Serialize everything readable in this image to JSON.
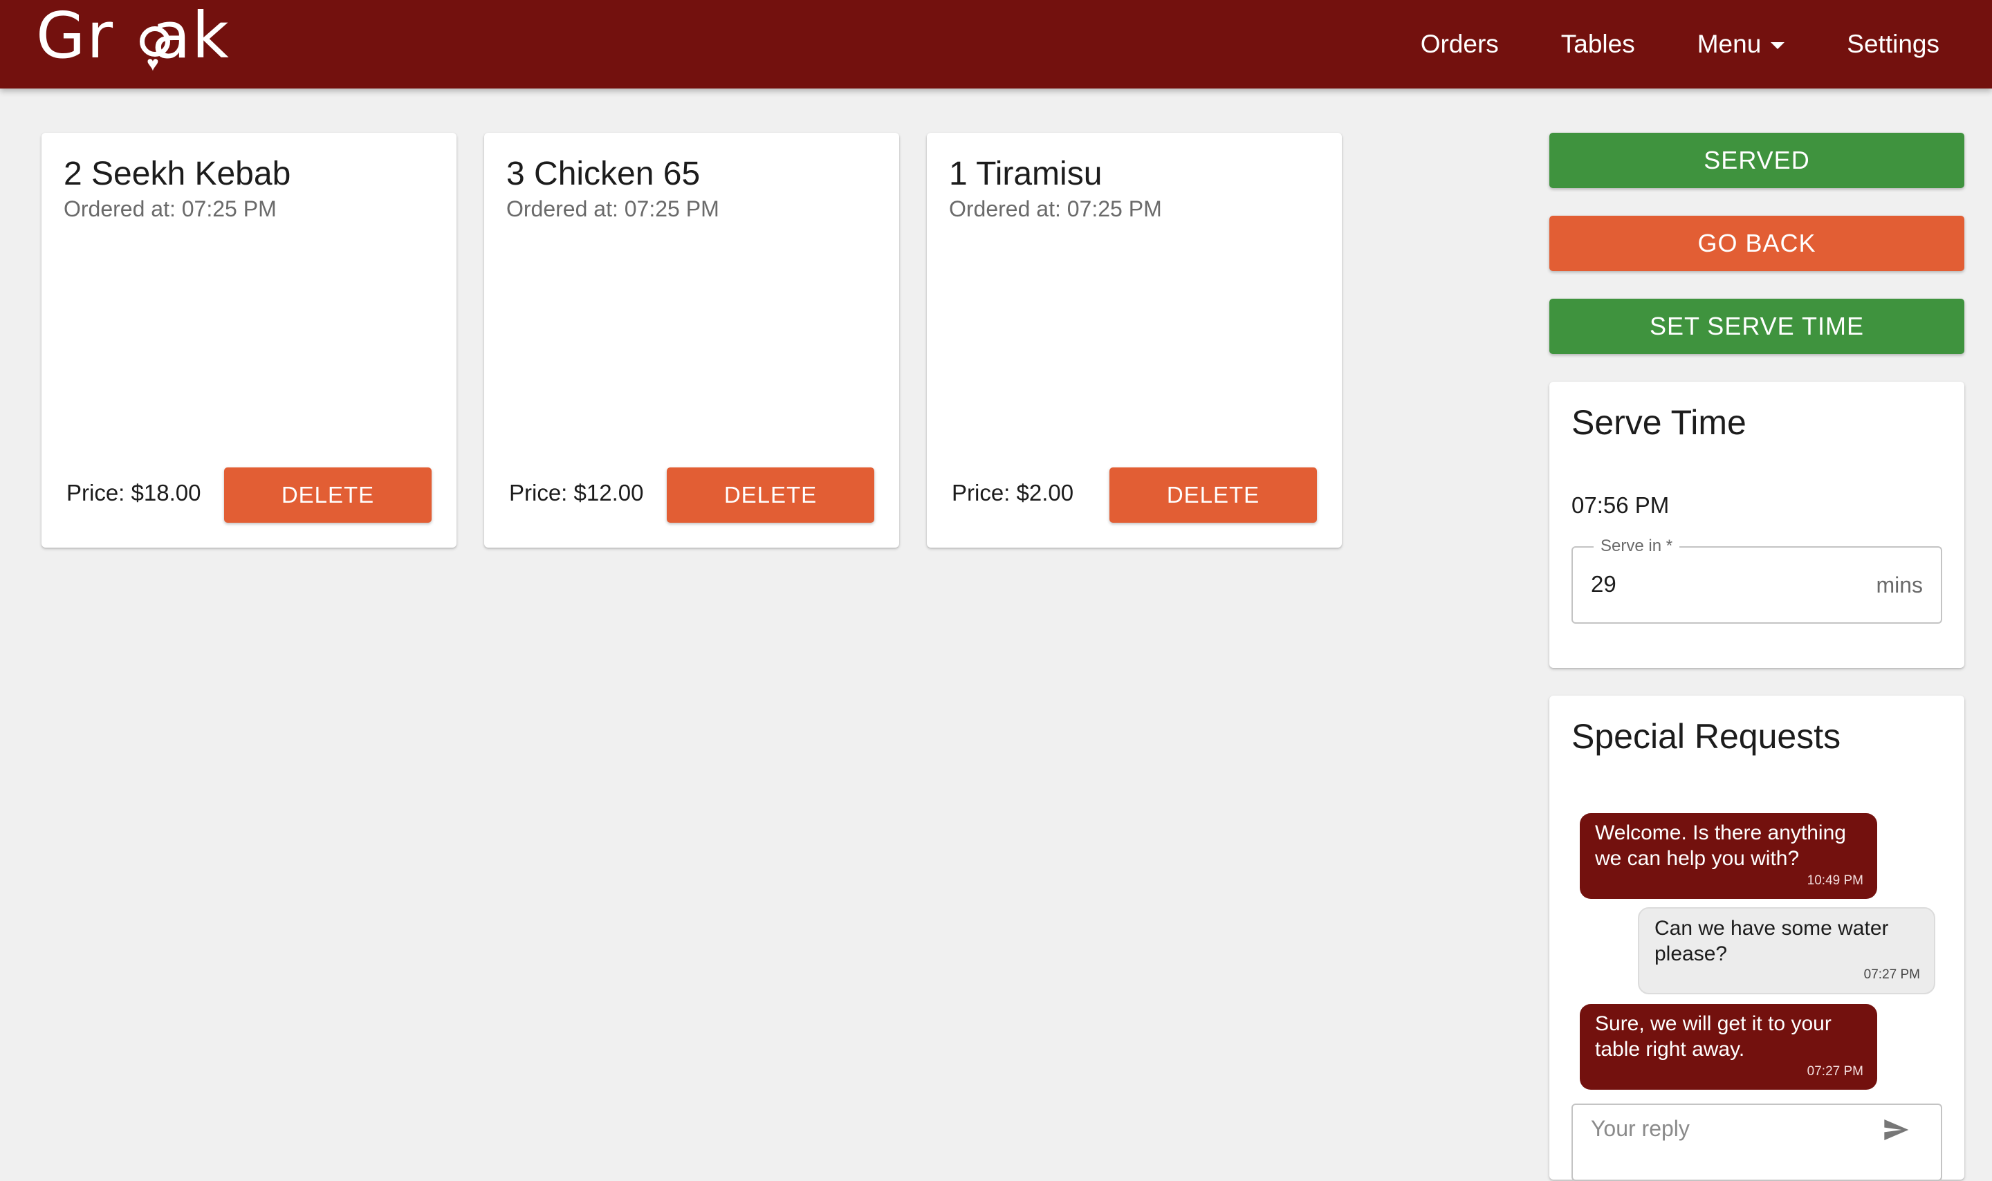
{
  "app": {
    "logo_text": "Grak",
    "brand_color": "#73110e",
    "accent_orange": "#e25e34",
    "accent_green": "#3f933e"
  },
  "nav": {
    "items": [
      {
        "label": "Orders"
      },
      {
        "label": "Tables"
      },
      {
        "label": "Menu",
        "has_dropdown": true
      },
      {
        "label": "Settings"
      }
    ]
  },
  "orders": [
    {
      "title": "2 Seekh Kebab",
      "ordered_at": "Ordered at: 07:25 PM",
      "price": "Price: $18.00",
      "delete_label": "DELETE"
    },
    {
      "title": "3 Chicken 65",
      "ordered_at": "Ordered at: 07:25 PM",
      "price": "Price: $12.00",
      "delete_label": "DELETE"
    },
    {
      "title": "1 Tiramisu",
      "ordered_at": "Ordered at: 07:25 PM",
      "price": "Price: $2.00",
      "delete_label": "DELETE"
    }
  ],
  "actions": {
    "served_label": "SERVED",
    "go_back_label": "GO BACK",
    "set_serve_time_label": "SET SERVE TIME"
  },
  "serve_time": {
    "title": "Serve Time",
    "time": "07:56 PM",
    "field_label": "Serve in *",
    "field_value": "29",
    "field_unit": "mins"
  },
  "special_requests": {
    "title": "Special Requests",
    "messages": [
      {
        "from": "staff",
        "text": "Welcome. Is there anything we can help you with?",
        "time": "10:49 PM"
      },
      {
        "from": "guest",
        "text": "Can we have some water please?",
        "time": "07:27 PM"
      },
      {
        "from": "staff",
        "text": "Sure, we will get it to your table right away.",
        "time": "07:27 PM"
      }
    ],
    "reply_placeholder": "Your reply",
    "send_icon": "send-icon"
  }
}
